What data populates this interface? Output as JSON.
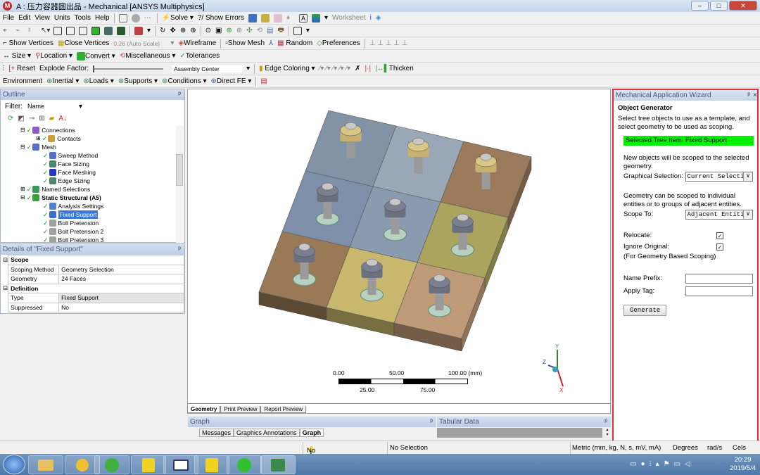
{
  "window": {
    "title": "A : 压力容器圆出品 - Mechanical [ANSYS Multiphysics]",
    "logo": "M"
  },
  "menu": [
    "File",
    "Edit",
    "View",
    "Units",
    "Tools",
    "Help"
  ],
  "toolbar1": {
    "solve": "Solve",
    "show_errors": "?/ Show Errors",
    "worksheet": "Worksheet"
  },
  "toolbar3": {
    "show_vertices": "Show Vertices",
    "close_vertices": "Close Vertices",
    "scale": "0.26 (Auto Scale)",
    "wireframe": "Wireframe",
    "show_mesh": "Show Mesh",
    "random": "Random",
    "preferences": "Preferences"
  },
  "toolbar4": {
    "size": "Size",
    "location": "Location",
    "convert": "Convert",
    "misc": "Miscellaneous",
    "tolerances": "Tolerances"
  },
  "toolbar5": {
    "reset": "Reset",
    "explode": "Explode Factor:",
    "assembly": "Assembly Center",
    "edge_coloring": "Edge Coloring",
    "thicken": "Thicken"
  },
  "toolbar6": {
    "environment": "Environment",
    "inertial": "Inertial",
    "loads": "Loads",
    "supports": "Supports",
    "conditions": "Conditions",
    "direct_fe": "Direct FE"
  },
  "outline": {
    "title": "Outline",
    "filter_label": "Filter:",
    "filter_value": "Name",
    "items": [
      {
        "label": "Connections",
        "level": 1,
        "color": "#8a5ac8"
      },
      {
        "label": "Contacts",
        "level": 2,
        "color": "#c8a040"
      },
      {
        "label": "Mesh",
        "level": 1,
        "color": "#5a70c8"
      },
      {
        "label": "Sweep Method",
        "level": 2,
        "color": "#5a70c8"
      },
      {
        "label": "Face Sizing",
        "level": 2,
        "color": "#4a8a6a"
      },
      {
        "label": "Face Meshing",
        "level": 2,
        "color": "#2a3ab8"
      },
      {
        "label": "Edge Sizing",
        "level": 2,
        "color": "#4a8a6a"
      },
      {
        "label": "Named Selections",
        "level": 1,
        "color": "#3a9a5a"
      },
      {
        "label": "Static Structural (A5)",
        "level": 1,
        "color": "#3aa03a",
        "bold": true
      },
      {
        "label": "Analysis Settings",
        "level": 2,
        "color": "#5a80c8"
      },
      {
        "label": "Fixed Support",
        "level": 2,
        "color": "#3a70c8",
        "selected": true
      },
      {
        "label": "Bolt Pretension",
        "level": 2,
        "color": "#a0a0a0"
      },
      {
        "label": "Bolt Pretension 2",
        "level": 2,
        "color": "#a0a0a0"
      },
      {
        "label": "Bolt Pretension 3",
        "level": 2,
        "color": "#a0a0a0"
      }
    ]
  },
  "details": {
    "title": "Details of \"Fixed Support\"",
    "sections": [
      {
        "name": "Scope",
        "rows": [
          [
            "Scoping Method",
            "Geometry Selection"
          ],
          [
            "Geometry",
            "24 Faces"
          ]
        ]
      },
      {
        "name": "Definition",
        "rows": [
          [
            "Type",
            "Fixed Support"
          ],
          [
            "Suppressed",
            "No"
          ]
        ]
      }
    ]
  },
  "viewport": {
    "tabs": [
      "Geometry",
      "Print Preview",
      "Report Preview"
    ],
    "scale": {
      "top": [
        "0.00",
        "50.00",
        "100.00 (mm)"
      ],
      "bottom": [
        "25.00",
        "75.00"
      ]
    },
    "tile_colors": [
      [
        "#8393a6",
        "#9aa7b6",
        "#9c7b5c"
      ],
      [
        "#7e90a9",
        "#8a9bb0",
        "#aaa45e"
      ],
      [
        "#9a7a56",
        "#c7b86e",
        "#bf9a78"
      ]
    ],
    "axes": {
      "x": "X",
      "y": "Y",
      "z": "Z"
    }
  },
  "graph": {
    "title": "Graph",
    "tabs": [
      "Messages",
      "Graphics Annotations",
      "Graph"
    ]
  },
  "tabular": {
    "title": "Tabular Data"
  },
  "wizard": {
    "title": "Mechanical Application Wizard",
    "heading": "Object Generator",
    "intro": "Select tree objects to use as a template, and select geometry to be used as scoping.",
    "selected": "Selected Tree Item: Fixed Support",
    "scoped_text": "New objects will be scoped to the selected geometry.",
    "graphical_label": "Graphical Selection:",
    "graphical_value": "Current Selecti",
    "geometry_text": "Geometry can be scoped to individual entities or to groups of adjacent entities.",
    "scope_label": "Scope To:",
    "scope_value": "Adjacent Entiti",
    "relocate": "Relocate:",
    "ignore": "Ignore Original:",
    "note": "(For Geometry Based Scoping)",
    "name_prefix": "Name Prefix:",
    "apply_tag": "Apply Tag:",
    "generate": "Generate"
  },
  "status": {
    "messages": "No Messages",
    "selection": "No Selection",
    "units": "Metric (mm, kg, N, s, mV, mA)",
    "degrees": "Degrees",
    "rads": "rad/s",
    "temp": "Cels"
  },
  "taskbar": {
    "time": "20:29",
    "date": "2019/5/4"
  }
}
